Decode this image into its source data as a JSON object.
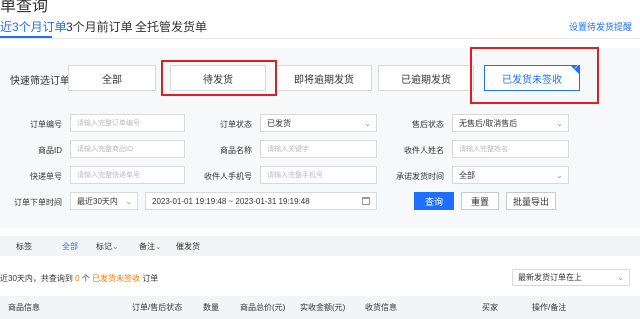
{
  "page": {
    "title": "单查询"
  },
  "tabs": [
    {
      "label": "近3个月订单",
      "active": true
    },
    {
      "label": "3个月前订单",
      "active": false
    },
    {
      "label": "全托管发货单",
      "active": false
    }
  ],
  "top_link": "设置待发货提醒",
  "quick_filter": {
    "label": "快速筛选订单",
    "buttons": [
      {
        "label": "全部",
        "selected": false,
        "highlighted": false
      },
      {
        "label": "待发货",
        "selected": false,
        "highlighted": true
      },
      {
        "label": "即将逾期发货",
        "selected": false,
        "highlighted": false
      },
      {
        "label": "已逾期发货",
        "selected": false,
        "highlighted": false
      },
      {
        "label": "已发货未签收",
        "selected": true,
        "highlighted": true
      }
    ]
  },
  "form": {
    "order_no": {
      "label": "订单编号",
      "placeholder": "请输入完整订单编号"
    },
    "order_status": {
      "label": "订单状态",
      "value": "已发货"
    },
    "after_sales": {
      "label": "售后状态",
      "value": "无售后/取消售后"
    },
    "product_id": {
      "label": "商品ID",
      "placeholder": "请输入完整商品ID"
    },
    "product_name": {
      "label": "商品名称",
      "placeholder": "请输入关键字"
    },
    "receiver_name": {
      "label": "收件人姓名",
      "placeholder": "请输入完整姓名"
    },
    "tracking_no": {
      "label": "快递单号",
      "placeholder": "请输入完整快递单号"
    },
    "receiver_phone": {
      "label": "收件人手机号",
      "placeholder": "请输入完整手机号"
    },
    "promise_time": {
      "label": "承诺发货时间",
      "value": "全部"
    },
    "order_time": {
      "label": "订单下单时间",
      "range_preset": "最近30天内",
      "date_range": "2023-01-01 19:19:48 ~ 2023-01-31 19:19:48"
    }
  },
  "actions": {
    "search": "查询",
    "reset": "重置",
    "export": "批量导出"
  },
  "filter_tabs": {
    "label": "标签",
    "items": [
      "全部",
      "标记",
      "备注",
      "催发货"
    ]
  },
  "summary": {
    "prefix": "近30天内，共查询到",
    "count": "0",
    "middle": "个",
    "status": "已发货未签收",
    "suffix": "订单"
  },
  "sort": {
    "value": "最新发货订单在上"
  },
  "table": {
    "headers": [
      "商品信息",
      "订单/售后状态",
      "数量",
      "商品总价(元)",
      "实收金额(元)",
      "收货信息",
      "买家",
      "操作/备注"
    ]
  },
  "colors": {
    "accent": "#1e6fff",
    "highlight": "#e02020",
    "count": "#ff7a00"
  }
}
